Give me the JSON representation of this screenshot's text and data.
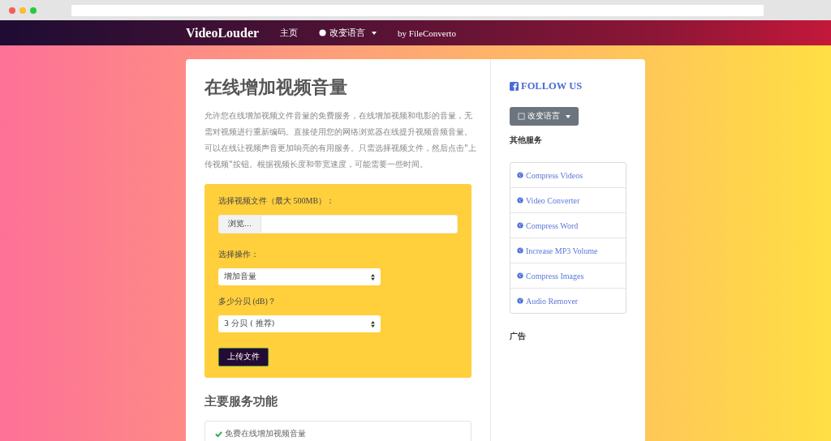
{
  "navbar": {
    "brand": "VideoLouder",
    "links": [
      {
        "label": "主页",
        "kind": "plain"
      },
      {
        "label": "改变语言",
        "kind": "dropdown"
      },
      {
        "label": "by FileConverto",
        "kind": "plain"
      }
    ]
  },
  "main": {
    "title": "在线增加视频音量",
    "intro": "允许您在线增加视频文件音量的免费服务，在线增加视频和电影的音量，无需对视频进行重新编码。直接使用您的网络浏览器在线提升视频音频音量。可以在线让视频声音更加响亮的有用服务。只需选择视频文件，然后点击\"上传视频\"按钮。根据视频长度和带宽速度，可能需要一些时间。",
    "form": {
      "file_label": "选择视频文件（最大 500MB）：",
      "browse_button": "浏览...",
      "action_label": "选择操作：",
      "action_value": "增加音量",
      "db_label": "多少分贝 (dB)？",
      "db_value": "3 分贝 ( 推荐)",
      "submit": "上传文件"
    },
    "features_title": "主要服务功能",
    "features": [
      "免费在线增加视频音量"
    ]
  },
  "sidebar": {
    "follow": "FOLLOW US",
    "language_button": "改变语言",
    "other_services_title": "其他服务",
    "services": [
      "Compress Videos",
      "Video Converter",
      "Compress Word",
      "Increase MP3 Volume",
      "Compress Images",
      "Audio Remover"
    ],
    "ads_title": "广告"
  }
}
